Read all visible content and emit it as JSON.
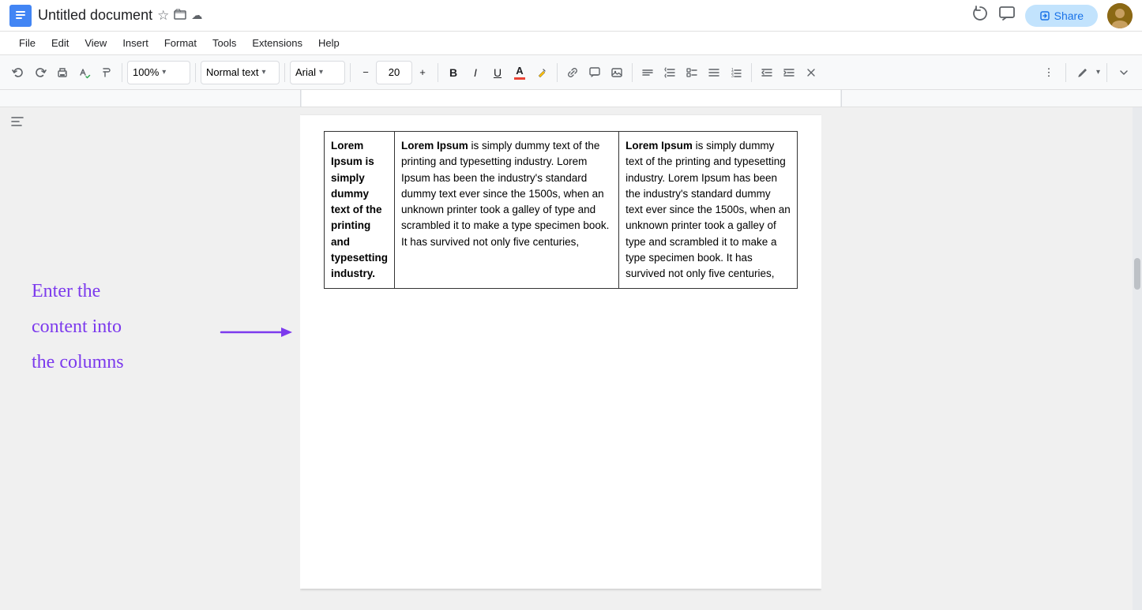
{
  "app": {
    "title": "Untitled document",
    "icon_char": "d"
  },
  "title_bar": {
    "doc_title": "Untitled document",
    "share_label": "Share",
    "star_icon": "☆",
    "folder_icon": "⊡",
    "cloud_icon": "☁"
  },
  "menu": {
    "items": [
      "File",
      "Edit",
      "View",
      "Insert",
      "Format",
      "Tools",
      "Extensions",
      "Help"
    ]
  },
  "toolbar": {
    "undo": "↩",
    "redo": "↪",
    "print": "🖨",
    "spell_check": "✓",
    "paint": "🖌",
    "zoom": "100%",
    "style_label": "Normal text",
    "font_label": "Arial",
    "font_size": "20",
    "bold": "B",
    "italic": "I",
    "underline": "U",
    "more_options": "⋮"
  },
  "content": {
    "annotation_line1": "Enter the",
    "annotation_line2": "content into",
    "annotation_line3": "the columns",
    "col1_text": "Lorem Ipsum is simply dummy text of the printing and typesetting industry.",
    "col2_text_bold": "Lorem Ipsum",
    "col2_text_rest": " is simply dummy text of the printing and typesetting industry. Lorem Ipsum has been the industry's standard dummy text ever since the 1500s, when an unknown printer took a galley of type and scrambled it to make a type specimen book. It has survived not only five centuries,",
    "col3_text_bold": "Lorem Ipsum",
    "col3_text_rest": " is simply dummy text of the printing and typesetting industry. Lorem Ipsum has been the industry's standard dummy text ever since the 1500s, when an unknown printer took a galley of type and scrambled it to make a type specimen book. It has survived not only five centuries,"
  }
}
